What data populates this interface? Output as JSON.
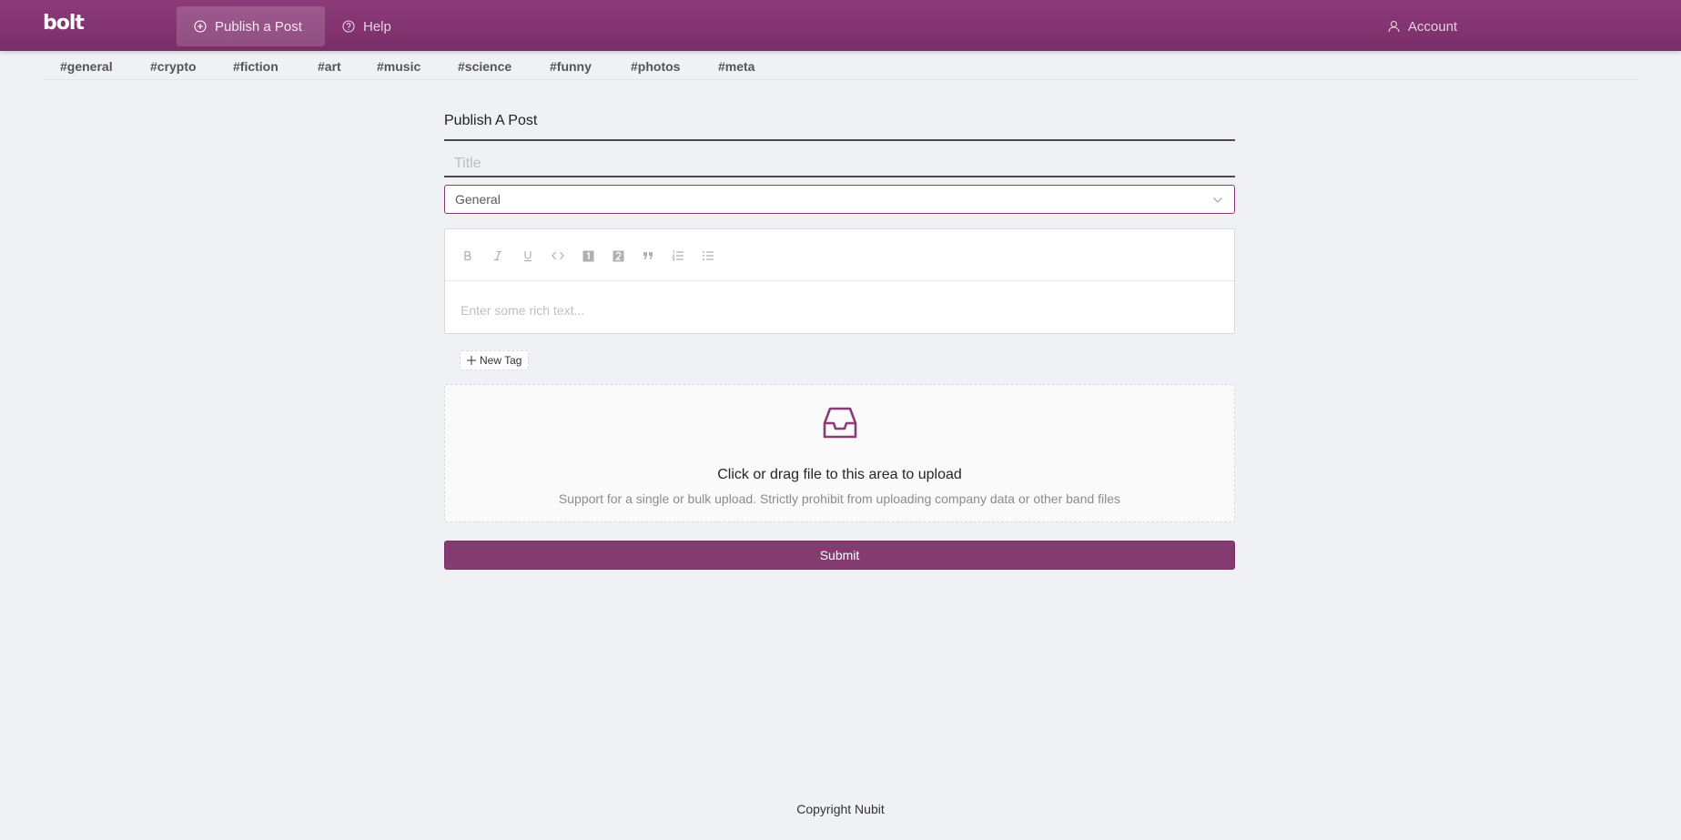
{
  "header": {
    "logo": "bolt",
    "nav": [
      {
        "label": "Publish a Post",
        "icon": "plus-circle-icon"
      },
      {
        "label": "Help",
        "icon": "question-circle-icon"
      }
    ],
    "account_label": "Account",
    "colors": {
      "header_bg": "#8d3a79",
      "accent": "#843b6f"
    }
  },
  "tags": [
    "#general",
    "#crypto",
    "#fiction",
    "#art",
    "#music",
    "#science",
    "#funny",
    "#photos",
    "#meta"
  ],
  "form": {
    "heading": "Publish A Post",
    "title_placeholder": "Title",
    "category_selected": "General",
    "editor_toolbar": [
      "bold-icon",
      "italic-icon",
      "underline-icon",
      "code-icon",
      "heading-one-icon",
      "heading-two-icon",
      "blockquote-icon",
      "numbered-list-icon",
      "bulleted-list-icon"
    ],
    "editor_placeholder": "Enter some rich text...",
    "new_tag_label": "New Tag",
    "upload_text": "Click or drag file to this area to upload",
    "upload_hint": "Support for a single or bulk upload. Strictly prohibit from uploading company data or other band files",
    "submit_label": "Submit"
  },
  "footer": {
    "text": "Copyright Nubit"
  }
}
